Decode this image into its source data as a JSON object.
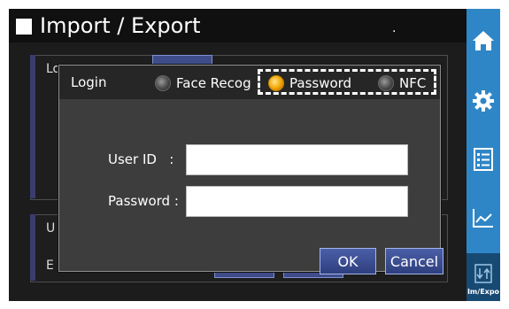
{
  "page": {
    "title": "Import / Export"
  },
  "background": {
    "top_panel_label_fragment": "Lo",
    "bottom_label_1_fragment": "U",
    "bottom_label_2_fragment": "E"
  },
  "dialog": {
    "title": "Login",
    "options": [
      {
        "label": "Face Recog",
        "selected": false
      },
      {
        "label": "Password",
        "selected": true
      },
      {
        "label": "NFC",
        "selected": false
      }
    ],
    "trailing_mark": ".",
    "fields": {
      "user_id_label": "User ID   :",
      "user_id_value": "",
      "password_label": "Password :",
      "password_value": ""
    },
    "ok_label": "OK",
    "cancel_label": "Cancel"
  },
  "sidebar": {
    "items": [
      {
        "icon": "home-icon"
      },
      {
        "icon": "gear-icon"
      },
      {
        "icon": "list-icon"
      },
      {
        "icon": "chart-icon"
      },
      {
        "icon": "import-export-icon",
        "label": "Im/Expo",
        "active": true
      }
    ]
  },
  "colors": {
    "sidebar": "#2f86c6",
    "sidebar_active": "#174a73",
    "selected_radio": "#f2a300",
    "button": "#3b4c92"
  }
}
